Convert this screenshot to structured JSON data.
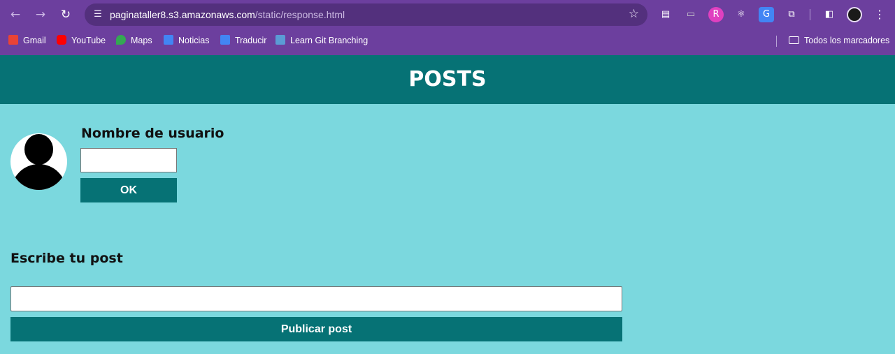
{
  "browser": {
    "url_host": "paginataller8.s3.amazonaws.com",
    "url_path": "/static/response.html",
    "bookmarks": [
      {
        "label": "Gmail",
        "icon": "gmail-icon",
        "color": "#ea4335"
      },
      {
        "label": "YouTube",
        "icon": "youtube-icon",
        "color": "#ff0000"
      },
      {
        "label": "Maps",
        "icon": "maps-icon",
        "color": "#34a853"
      },
      {
        "label": "Noticias",
        "icon": "news-icon",
        "color": "#4285f4"
      },
      {
        "label": "Traducir",
        "icon": "translate-icon",
        "color": "#4285f4"
      },
      {
        "label": "Learn Git Branching",
        "icon": "git-icon",
        "color": "#5b9bd5"
      }
    ],
    "all_bookmarks": "Todos los marcadores"
  },
  "page": {
    "title": "POSTS",
    "username_label": "Nombre de usuario",
    "username_value": "",
    "ok_label": "OK",
    "post_label": "Escribe tu post",
    "post_value": "",
    "publish_label": "Publicar post"
  },
  "colors": {
    "accent": "#067275",
    "background": "#7bd8de",
    "browser_frame": "#6c3f9e"
  }
}
